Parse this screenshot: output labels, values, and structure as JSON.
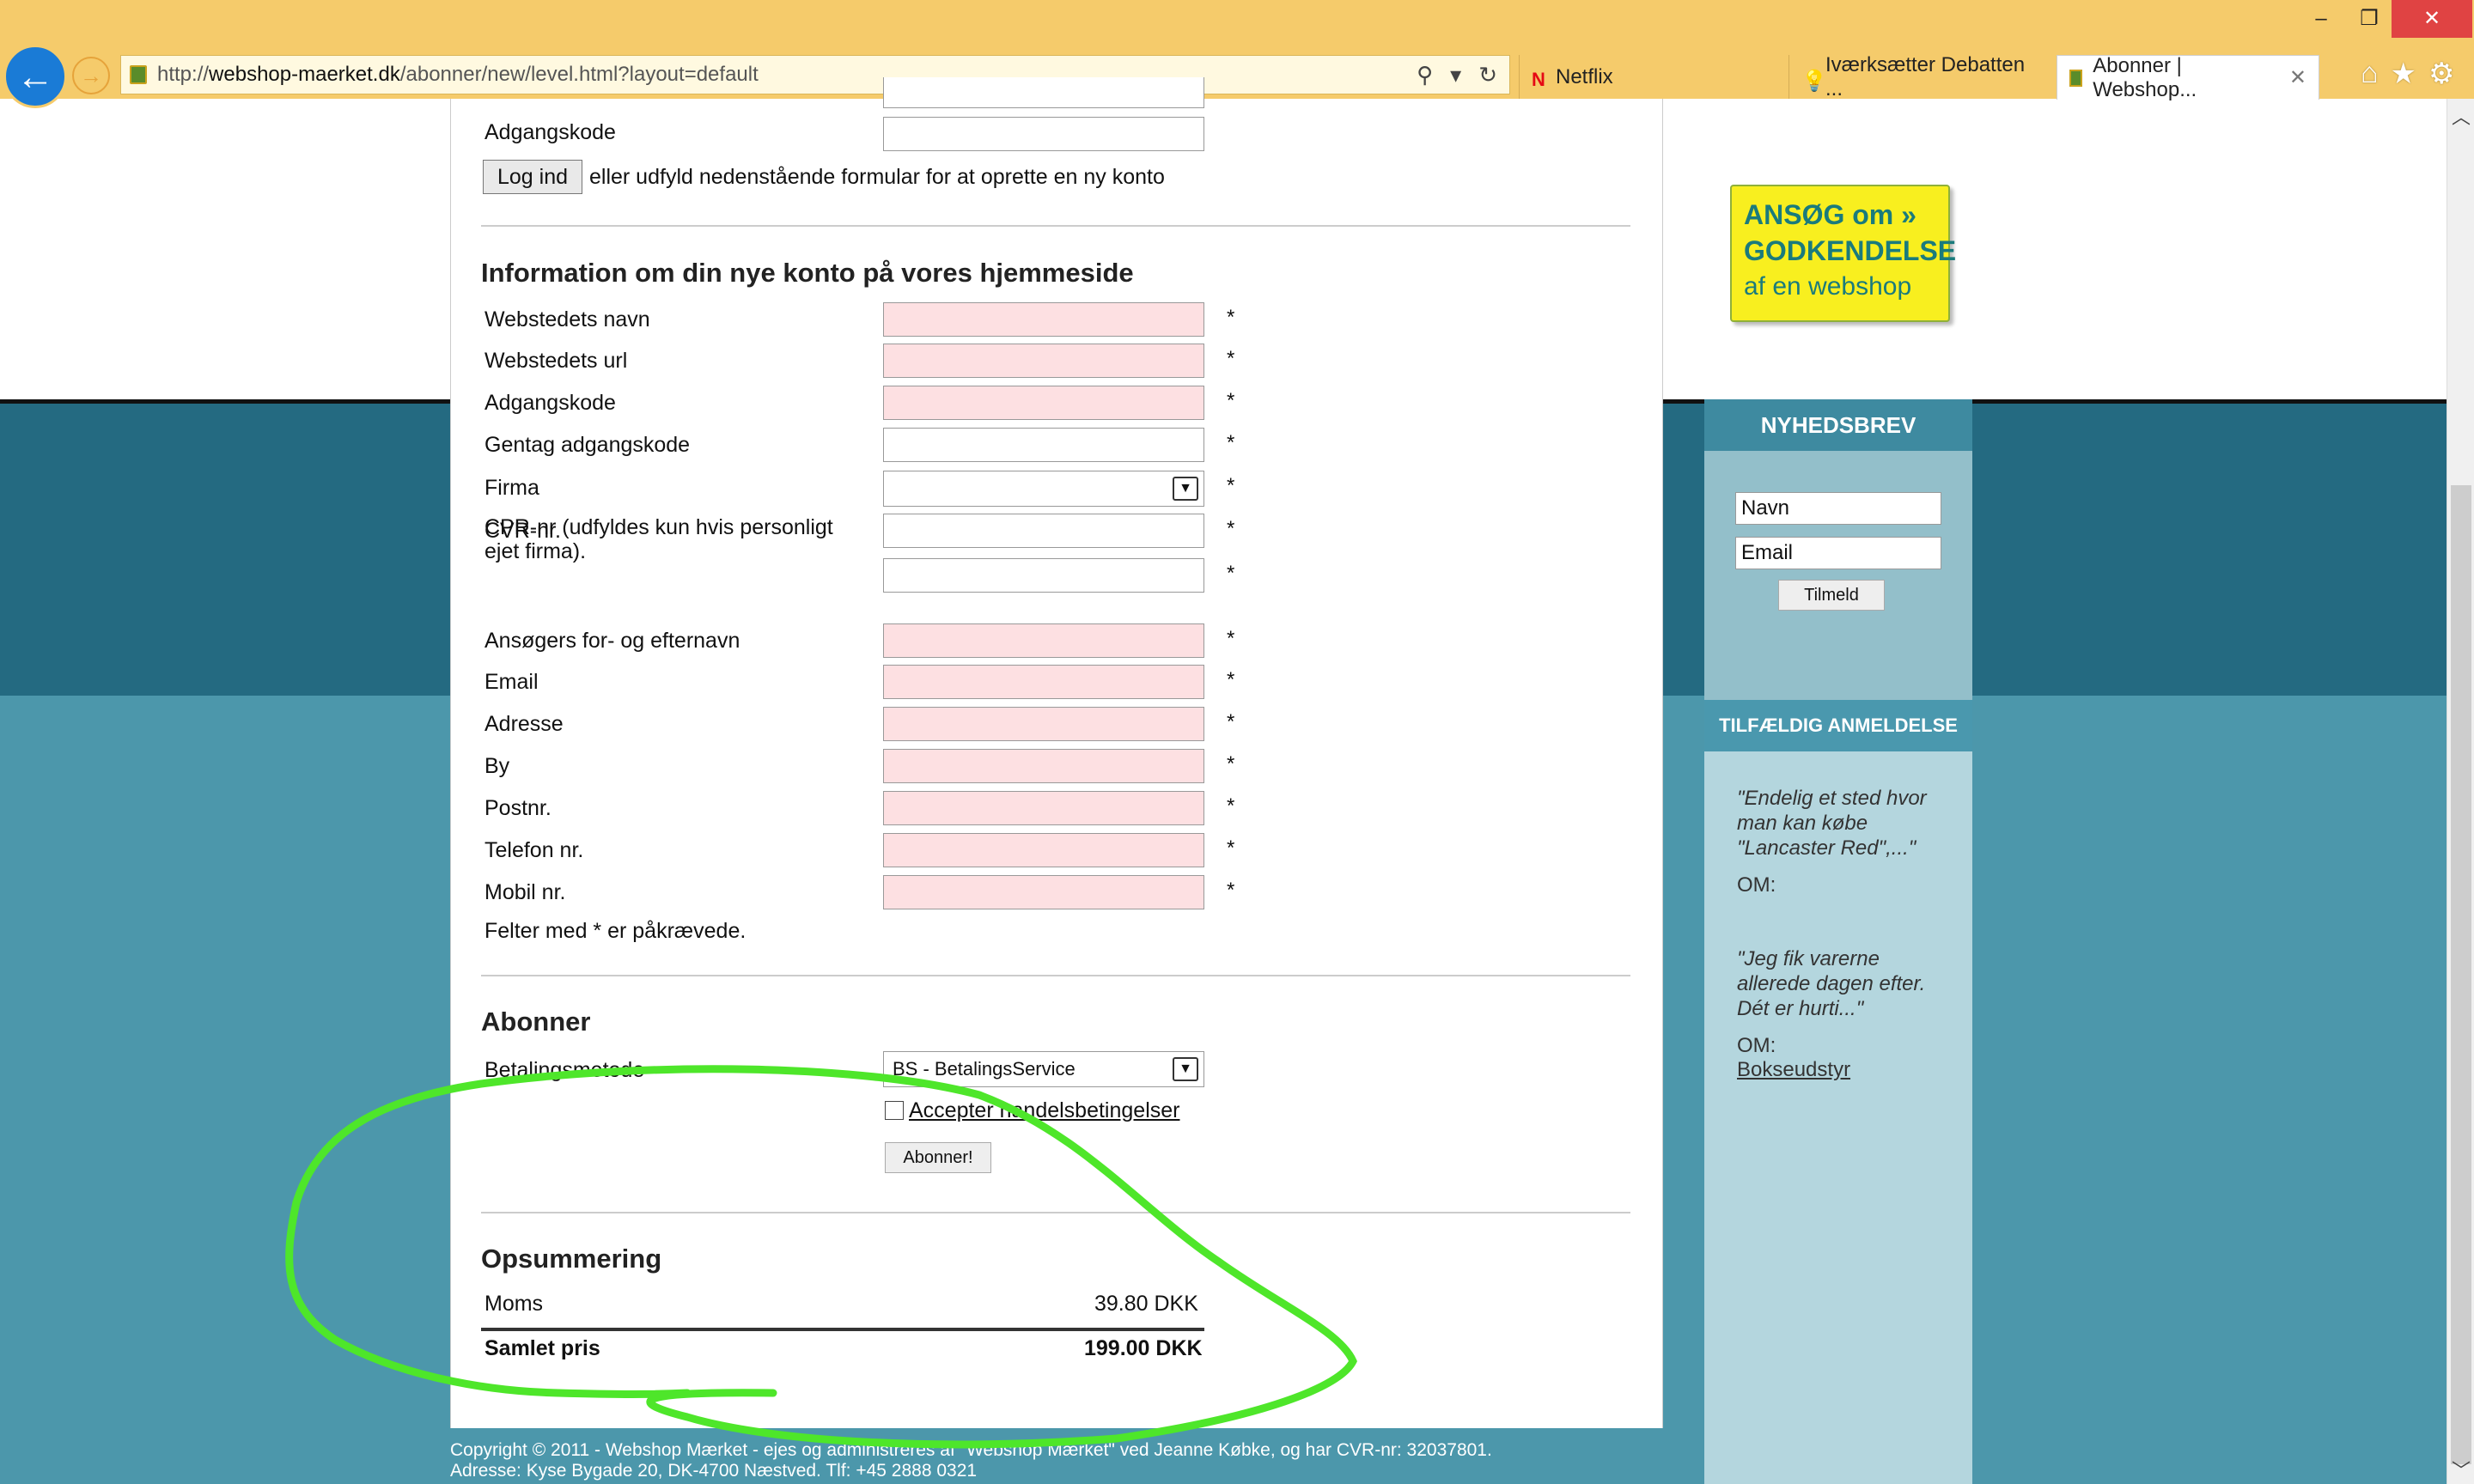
{
  "browser": {
    "url_prefix": "http://",
    "url_host": "webshop-maerket.dk",
    "url_path": "/abonner/new/level.html?layout=default",
    "tabs": [
      {
        "label": "Netflix",
        "active": false
      },
      {
        "label": "Iværksætter Debatten ...",
        "active": false
      },
      {
        "label": "Abonner | Webshop...",
        "active": true
      }
    ],
    "window_controls": {
      "minimize": "–",
      "restore": "❐",
      "close": "✕"
    }
  },
  "login": {
    "password_label": "Adgangskode",
    "login_button": "Log ind",
    "login_hint": "eller udfyld nedenstående formular for at oprette en ny konto"
  },
  "account": {
    "title": "Information om din nye konto på vores hjemmeside",
    "fields": [
      {
        "label": "Webstedets navn",
        "required": true
      },
      {
        "label": "Webstedets url",
        "required": true
      },
      {
        "label": "Adgangskode",
        "required": true
      },
      {
        "label": "Gentag adgangskode",
        "required": false
      },
      {
        "label": "Firma",
        "required": false
      },
      {
        "label": "CVR-nr.",
        "required": false
      },
      {
        "label": "CPR-nr (udfyldes kun hvis personligt",
        "label2": "ejet firma).",
        "required": false
      },
      {
        "label": "Ansøgers for- og efternavn",
        "required": true
      },
      {
        "label": "Email",
        "required": true
      },
      {
        "label": "Adresse",
        "required": true
      },
      {
        "label": "By",
        "required": true
      },
      {
        "label": "Postnr.",
        "required": true
      },
      {
        "label": "Telefon nr.",
        "required": true
      },
      {
        "label": "Mobil nr.",
        "required": true
      }
    ],
    "star": "*",
    "required_note": "Felter med * er påkrævede."
  },
  "subscribe": {
    "title": "Abonner",
    "payment_label": "Betalingsmetode",
    "payment_value": "BS - BetalingsService",
    "terms_label": "Accepter handelsbetingelser",
    "submit_label": "Abonner!"
  },
  "summary": {
    "title": "Opsummering",
    "vat_label": "Moms",
    "vat_value": "39.80 DKK",
    "total_label": "Samlet pris",
    "total_value": "199.00 DKK"
  },
  "sidebar": {
    "promo_line1": "ANSØG om »",
    "promo_line2": "GODKENDELSE",
    "promo_line3": "af en webshop",
    "newsletter_title": "NYHEDSBREV",
    "name_placeholder": "Navn",
    "email_placeholder": "Email",
    "signup_button": "Tilmeld",
    "review_title": "TILFÆLDIG ANMELDELSE",
    "reviews": [
      {
        "quote": "\"Endelig et sted hvor man kan købe \"Lancaster Red\",...\"",
        "om": "OM:",
        "link": ""
      },
      {
        "quote": "\"Jeg fik varerne allerede dagen efter. Dét er hurti...\"",
        "om": "OM:",
        "link": "Bokseudstyr"
      }
    ]
  },
  "footer": {
    "line1": "Copyright © 2011 - Webshop Mærket - ejes og administreres af \"Webshop Mærket\" ved Jeanne Købke, og har CVR-nr: 32037801.",
    "line2": "Adresse: Kyse Bygade 20, DK-4700 Næstved. Tlf: +45 2888 0321"
  },
  "colors": {
    "page_bg": "#4c97ab",
    "dark_band": "#246a81",
    "required_field": "#fde0e2",
    "annotation": "#4ee62a",
    "browser_chrome": "#f5cb6b"
  }
}
